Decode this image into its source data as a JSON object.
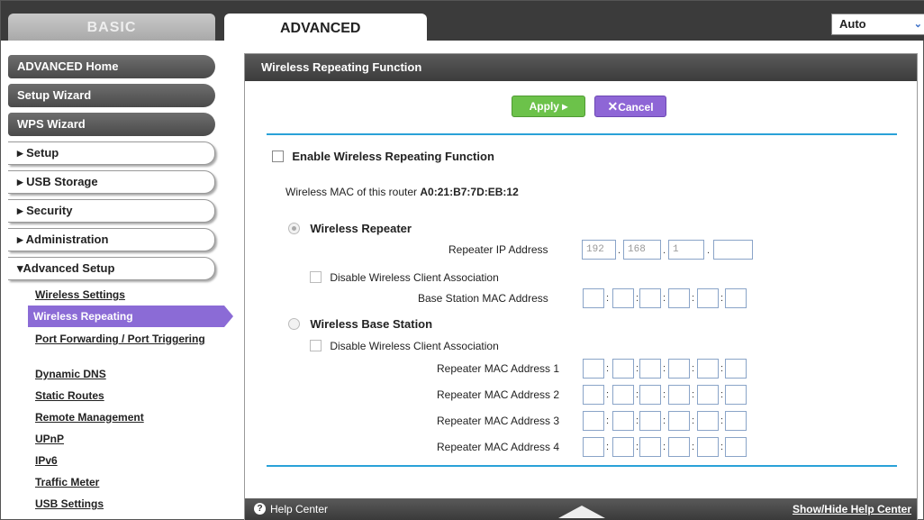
{
  "top_tabs": {
    "basic": "BASIC",
    "advanced": "ADVANCED"
  },
  "language": {
    "selected": "Auto"
  },
  "sidebar": {
    "dark_items": [
      "ADVANCED Home",
      "Setup Wizard",
      "WPS Wizard"
    ],
    "sections": [
      "▸ Setup",
      "▸ USB Storage",
      "▸ Security",
      "▸ Administration",
      "▾Advanced Setup"
    ],
    "sublinks": [
      "Wireless Settings",
      "Wireless Repeating",
      "Port Forwarding / Port Triggering",
      "Dynamic DNS",
      "Static Routes",
      "Remote Management",
      "UPnP",
      "IPv6",
      "Traffic Meter",
      "USB Settings"
    ],
    "active_sublink": "Wireless Repeating"
  },
  "panel": {
    "title": "Wireless Repeating Function",
    "apply_label": "Apply ▸",
    "cancel_label": "Cancel",
    "enable_label": "Enable Wireless Repeating Function",
    "mac_prefix": "Wireless MAC of this router",
    "mac_value": "A0:21:B7:7D:EB:12",
    "repeater": {
      "label": "Wireless Repeater",
      "ip_label": "Repeater IP Address",
      "ip_octets": [
        "192",
        "168",
        "1",
        ""
      ],
      "disable_assoc_label": "Disable Wireless Client Association",
      "base_mac_label": "Base Station MAC Address"
    },
    "base_station": {
      "label": "Wireless Base Station",
      "disable_assoc_label": "Disable Wireless Client Association",
      "repeater_mac_labels": [
        "Repeater MAC Address 1",
        "Repeater MAC Address 2",
        "Repeater MAC Address 3",
        "Repeater MAC Address 4"
      ]
    }
  },
  "footer": {
    "help_label": "Help Center",
    "toggle_label": "Show/Hide Help Center"
  },
  "colors": {
    "accent": "#2aa2d8",
    "active_nav": "#8b6bd6",
    "apply": "#6cc24a",
    "cancel": "#8e66d6"
  }
}
